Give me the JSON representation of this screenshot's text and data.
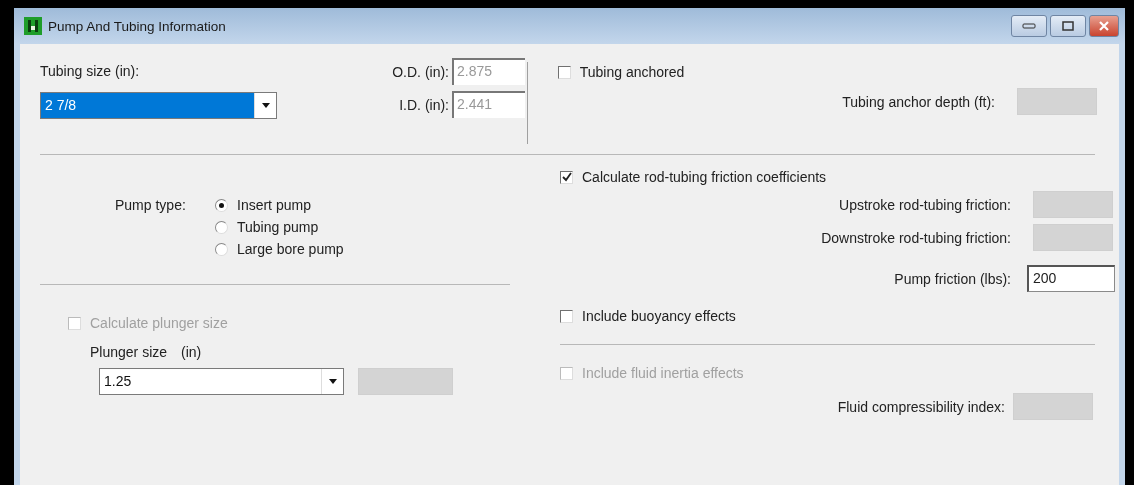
{
  "window": {
    "title": "Pump And Tubing Information"
  },
  "tubing": {
    "label": "Tubing size (in):",
    "value": "2 7/8",
    "od_label": "O.D. (in):",
    "od_value": "2.875",
    "id_label": "I.D. (in):",
    "id_value": "2.441"
  },
  "anchor": {
    "checkbox": {
      "label": "Tubing anchored",
      "checked": false,
      "disabled": false
    },
    "depth_label": "Tubing anchor depth (ft):",
    "depth_disabled": true
  },
  "pump_type": {
    "label": "Pump type:",
    "options": [
      {
        "label": "Insert pump",
        "selected": true
      },
      {
        "label": "Tubing pump",
        "selected": false
      },
      {
        "label": "Large bore pump",
        "selected": false
      }
    ]
  },
  "plunger": {
    "checkbox": {
      "label": "Calculate plunger size",
      "checked": false,
      "disabled": true
    },
    "label": "Plunger size",
    "unit": "(in)",
    "value": "1.25",
    "extra_disabled": true
  },
  "friction": {
    "checkbox": {
      "label": "Calculate rod-tubing friction coefficients",
      "checked": true,
      "disabled": false
    },
    "fields": [
      {
        "label": "Upstroke rod-tubing friction:",
        "disabled": true
      },
      {
        "label": "Downstroke rod-tubing friction:",
        "disabled": true
      },
      {
        "label": "Pump friction (lbs):",
        "value": "200",
        "disabled": false
      }
    ]
  },
  "buoyancy": {
    "label": "Include buoyancy effects",
    "checked": false,
    "disabled": false
  },
  "inertia": {
    "checkbox": {
      "label": "Include fluid inertia effects",
      "checked": false,
      "disabled": true
    },
    "compress_label": "Fluid compressibility index:",
    "compress_disabled": true
  }
}
